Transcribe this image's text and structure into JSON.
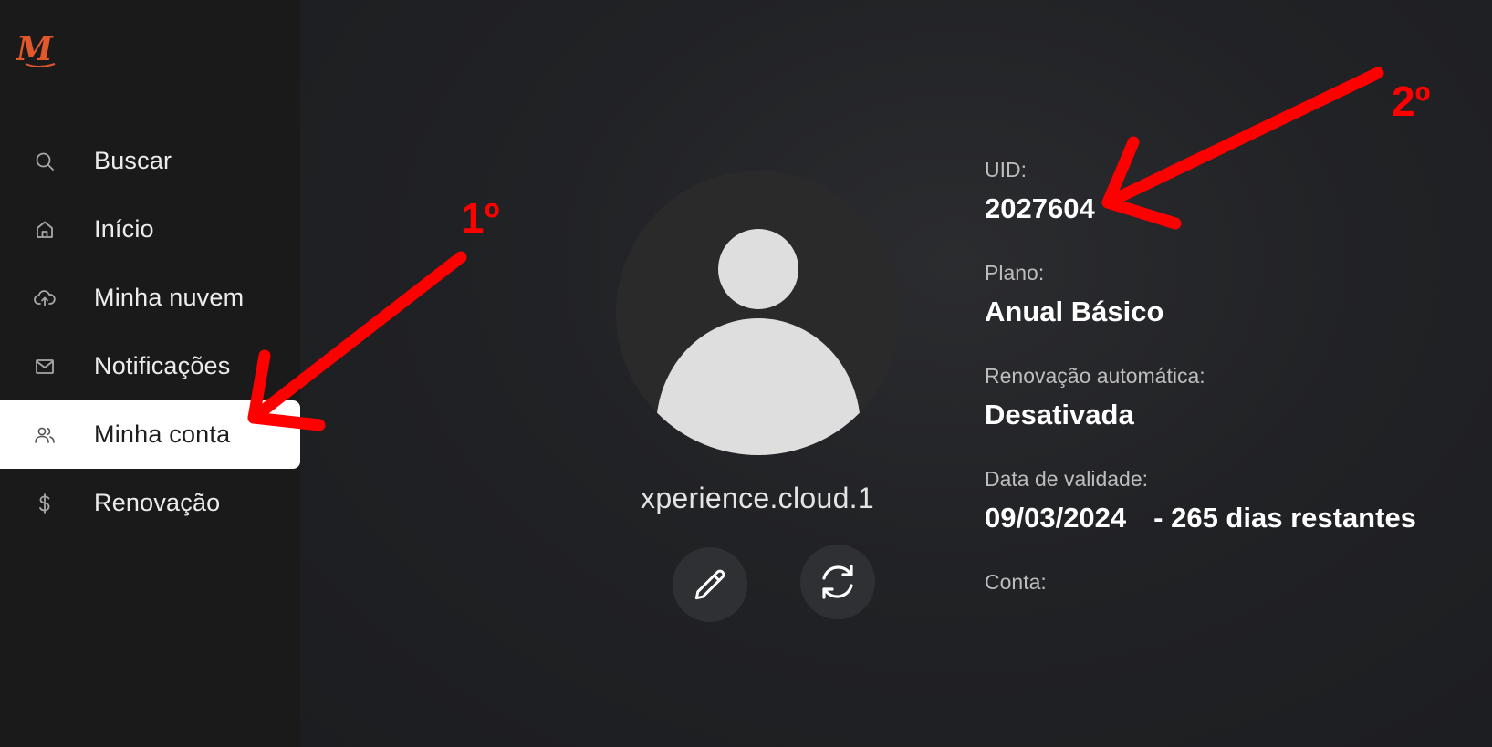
{
  "sidebar": {
    "logo": "M",
    "items": [
      {
        "label": "Buscar",
        "icon": "search-icon"
      },
      {
        "label": "Início",
        "icon": "home-icon"
      },
      {
        "label": "Minha nuvem",
        "icon": "cloud-upload-icon"
      },
      {
        "label": "Notificações",
        "icon": "mail-icon"
      },
      {
        "label": "Minha conta",
        "icon": "users-icon",
        "active": true
      },
      {
        "label": "Renovação",
        "icon": "dollar-icon"
      }
    ]
  },
  "profile": {
    "username": "xperience.cloud.1"
  },
  "info": {
    "uid_label": "UID:",
    "uid_value": "2027604",
    "plan_label": "Plano:",
    "plan_value": "Anual Básico",
    "renewal_label": "Renovação automática:",
    "renewal_value": "Desativada",
    "expiry_label": "Data de validade:",
    "expiry_date": "09/03/2024",
    "expiry_remaining": "- 265 dias restantes",
    "account_label": "Conta:"
  },
  "annotations": {
    "step1": "1º",
    "step2": "2º",
    "color": "#ff0000"
  },
  "colors": {
    "logo": "#e2572b",
    "active_bg": "#ffffff",
    "sidebar_bg": "#1a1a1a"
  }
}
